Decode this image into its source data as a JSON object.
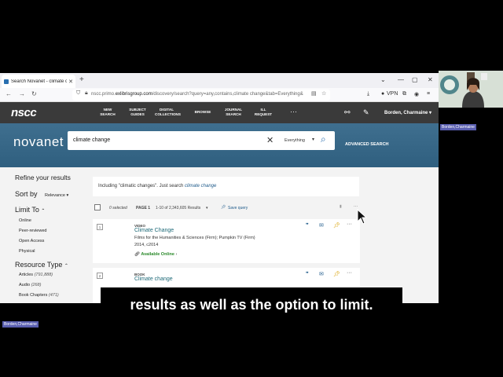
{
  "browser": {
    "tab_title": "Search Novanet - climate chan...",
    "url_prefix": "nscc.primo.",
    "url_domain": "exlibrisgroup.com",
    "url_rest": "/discovery/search?query=any,contains,climate change&tab=Everything&",
    "vpn_label": "VPN"
  },
  "site": {
    "logo": "nscc",
    "nav": [
      "NEW SEARCH",
      "SUBJECT GUIDES",
      "DIGITAL COLLECTIONS",
      "BROWSE",
      "JOURNAL SEARCH",
      "ILL REQUEST"
    ],
    "more": "···",
    "user": "Borden, Charmaine ▾"
  },
  "search": {
    "brand": "novanet",
    "query": "climate change",
    "scope": "Everything",
    "advanced": "ADVANCED SEARCH"
  },
  "refine": {
    "heading": "Refine your results",
    "sort_label": "Sort by",
    "sort_value": "Relevance",
    "limit_heading": "Limit To",
    "limit_items": [
      "Online",
      "Peer-reviewed",
      "Open Access",
      "Physical"
    ],
    "type_heading": "Resource Type",
    "type_items": [
      {
        "label": "Articles",
        "count": "(791,888)"
      },
      {
        "label": "Audio",
        "count": "(268)"
      },
      {
        "label": "Book Chapters",
        "count": "(471)"
      }
    ]
  },
  "results": {
    "suggest_prefix": "Including \"climatic changes\". Just search ",
    "suggest_link": "climate change",
    "selected": "0 selected",
    "page": "PAGE 1",
    "range": "1-10 of 2,343,605 Results",
    "save_query": "Save query",
    "items": [
      {
        "num": "1",
        "type": "VIDEO",
        "title": "Climate Change",
        "meta1": "Films for the Humanities & Sciences (Firm); Pumpkin TV (Firm)",
        "meta2": "2014, c2014",
        "availability": "Available Online"
      },
      {
        "num": "2",
        "type": "BOOK",
        "title": "Climate change"
      }
    ]
  },
  "caption": "results as well as the option to limit.",
  "participants": {
    "video_name": "Borden,Charmaine",
    "bottom_name": "Borden,Charmaine"
  }
}
